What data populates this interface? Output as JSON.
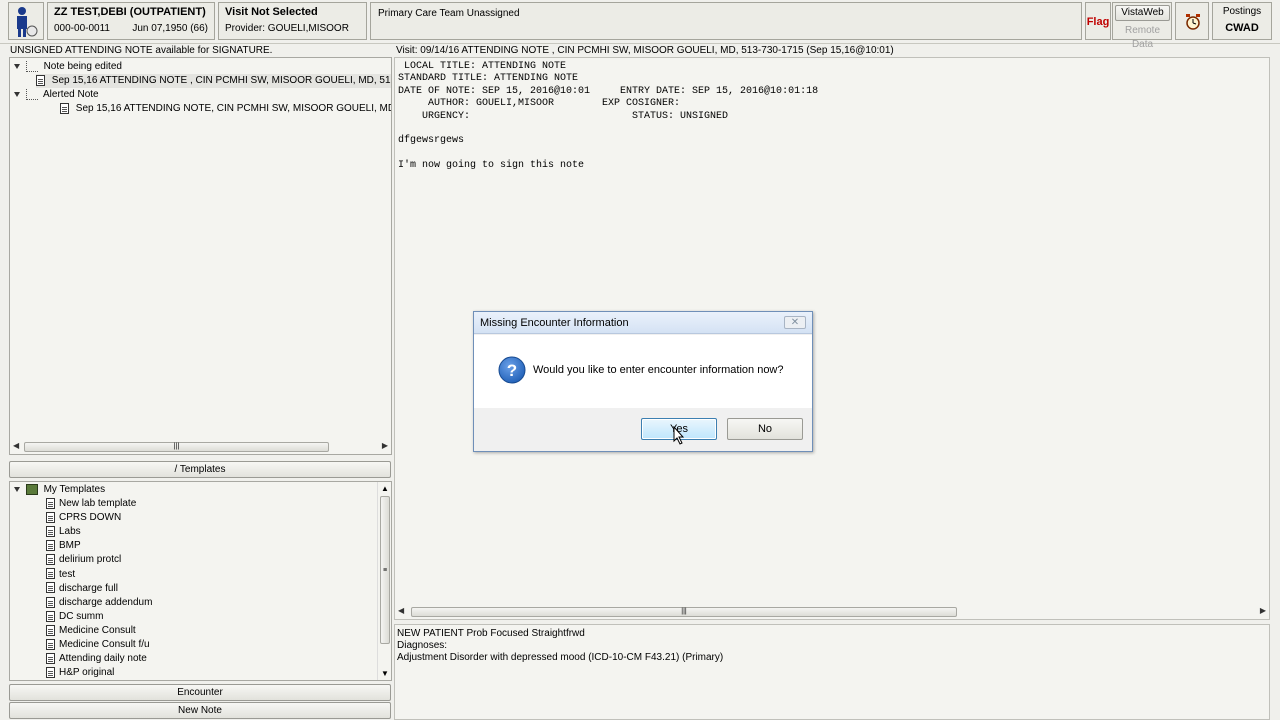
{
  "header": {
    "patient_name": "ZZ TEST,DEBI (OUTPATIENT)",
    "patient_id": "000-00-0011",
    "patient_dob": "Jun 07,1950 (66)",
    "visit_status": "Visit Not Selected",
    "provider_label": "Provider:",
    "provider_name": "GOUELI,MISOOR",
    "care_team": "Primary Care Team Unassigned",
    "flag_label": "Flag",
    "vistaweb_label": "VistaWeb",
    "remote_data_label": "Remote Data",
    "postings_label": "Postings",
    "cwad_label": "CWAD"
  },
  "left_panel": {
    "title": "UNSIGNED ATTENDING NOTE available for SIGNATURE.",
    "tree": {
      "group1": "Note being edited",
      "group1_item": "Sep 15,16  ATTENDING NOTE , CIN PCMHI SW, MISOOR GOUELI, MD, 51",
      "group2": "Alerted Note",
      "group2_item": "Sep 15,16  ATTENDING NOTE, CIN PCMHI SW, MISOOR GOUELI, MD, !"
    },
    "templates_button": "/ Templates",
    "templates_root": "My Templates",
    "templates": [
      "New lab template",
      "CPRS DOWN",
      "Labs",
      "BMP",
      "delirium protcl",
      "test",
      "discharge full",
      "discharge addendum",
      "DC summ",
      "Medicine Consult",
      "Medicine Consult f/u",
      "Attending daily note",
      "H&P original"
    ],
    "encounter_button": "Encounter",
    "new_note_button": "New Note"
  },
  "right_panel": {
    "visit_header": "Visit: 09/14/16   ATTENDING NOTE , CIN PCMHI SW, MISOOR GOUELI, MD, 513-730-1715  (Sep 15,16@10:01)",
    "note_lines": [
      " LOCAL TITLE: ATTENDING NOTE",
      "STANDARD TITLE: ATTENDING NOTE",
      "DATE OF NOTE: SEP 15, 2016@10:01     ENTRY DATE: SEP 15, 2016@10:01:18",
      "     AUTHOR: GOUELI,MISOOR        EXP COSIGNER:",
      "    URGENCY:                           STATUS: UNSIGNED",
      "",
      "dfgewsrgews",
      "",
      "I'm now going to sign this note"
    ],
    "encounter_line1": "NEW PATIENT Prob Focused  Straightfrwd",
    "encounter_line2": "Diagnoses:",
    "encounter_line3": "Adjustment Disorder with depressed mood (ICD-10-CM F43.21) (Primary)"
  },
  "dialog": {
    "title": "Missing Encounter Information",
    "message": "Would you like to enter encounter information now?",
    "yes_label": "Yes",
    "no_label": "No",
    "icon": "question-icon"
  },
  "colors": {
    "background": "#f0f0ec",
    "dialog_bg": "#f0f0f0",
    "flag_red": "#c00000",
    "question_blue": "#1f5fb6"
  }
}
